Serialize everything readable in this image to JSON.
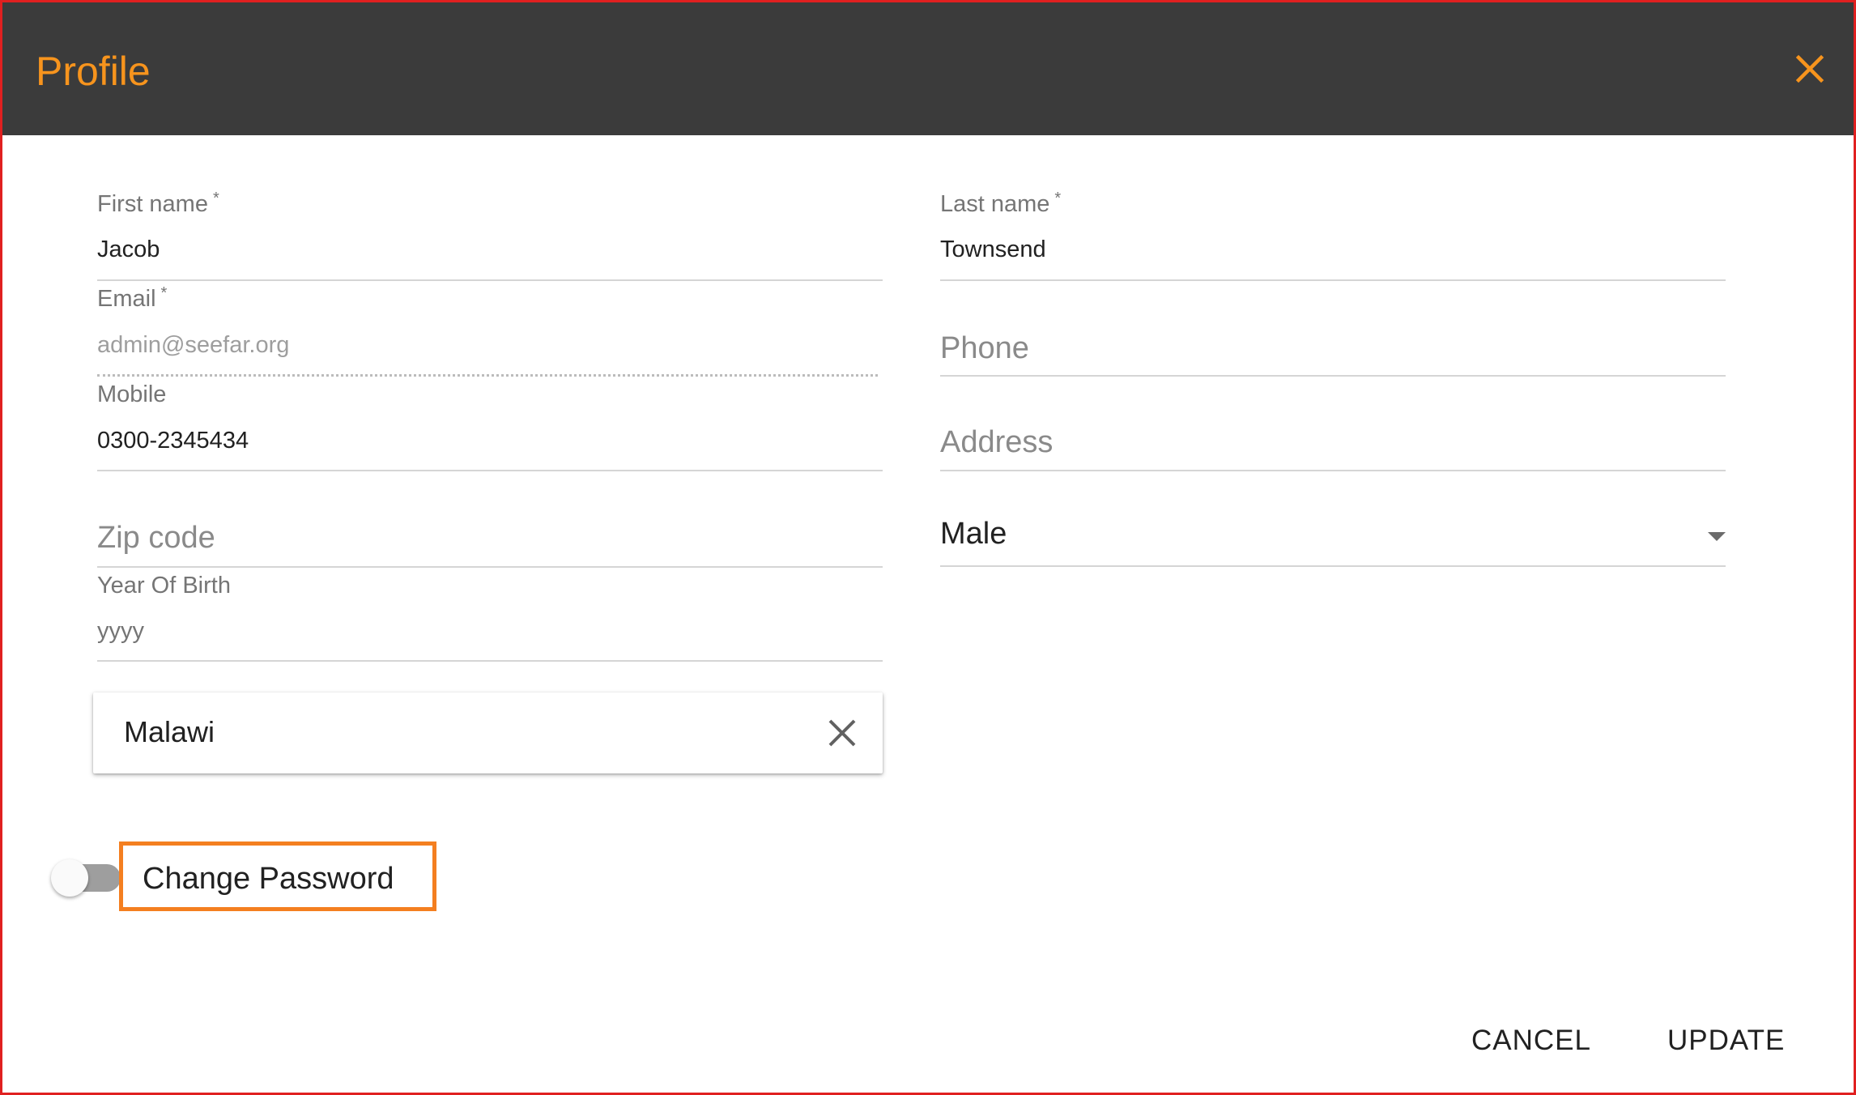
{
  "dialog": {
    "title": "Profile",
    "accent_color": "#f7941d",
    "header_color": "#3b3b3b",
    "close_icon": "close-icon"
  },
  "form": {
    "first_name": {
      "label": "First name",
      "required_mark": "*",
      "value": "Jacob"
    },
    "last_name": {
      "label": "Last name",
      "required_mark": "*",
      "value": "Townsend"
    },
    "email": {
      "label": "Email",
      "required_mark": "*",
      "value": "admin@seefar.org"
    },
    "phone": {
      "placeholder": "Phone"
    },
    "mobile": {
      "label": "Mobile",
      "value": "0300-2345434"
    },
    "address": {
      "placeholder": "Address"
    },
    "zip_code": {
      "placeholder": "Zip code"
    },
    "gender": {
      "value": "Male"
    },
    "year_of_birth": {
      "label": "Year Of Birth",
      "placeholder": "yyyy"
    },
    "country": {
      "value": "Malawi",
      "clear_icon": "close-icon"
    }
  },
  "change_password": {
    "label": "Change Password",
    "enabled": false,
    "highlight_color": "#f47f20"
  },
  "actions": {
    "cancel": "CANCEL",
    "update": "UPDATE"
  }
}
